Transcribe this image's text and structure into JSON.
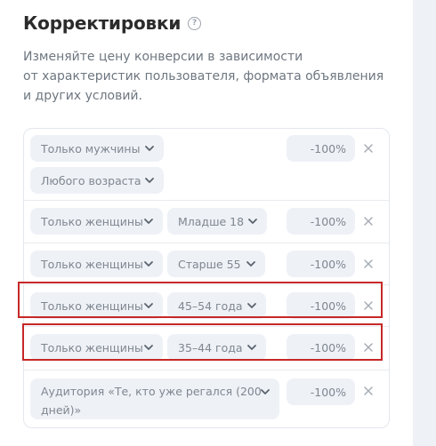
{
  "header": {
    "title": "Корректировки",
    "help_icon": "question-circle-icon",
    "description_lines": [
      "Изменяйте цену конверсии в зависимости",
      "от характеристик пользователя, формата объявления",
      "и других условий."
    ]
  },
  "rows": [
    {
      "gender": "Только мужчины",
      "age": "Любого возраста",
      "percent": "-100%"
    },
    {
      "gender": "Только женщины",
      "age": "Младше 18",
      "percent": "-100%"
    },
    {
      "gender": "Только женщины",
      "age": "Старше 55",
      "percent": "-100%"
    },
    {
      "gender": "Только женщины",
      "age": "45–54 года",
      "percent": "-100%"
    },
    {
      "gender": "Только женщины",
      "age": "35–44 года",
      "percent": "-100%"
    },
    {
      "audience": "Аудитория «Те, кто уже регался (200 дней)»",
      "percent": "-100%"
    }
  ],
  "colors": {
    "text_primary": "#2b2b2b",
    "text_secondary": "#6e7780",
    "control_bg": "#eef1f6",
    "highlight": "#c62828"
  }
}
